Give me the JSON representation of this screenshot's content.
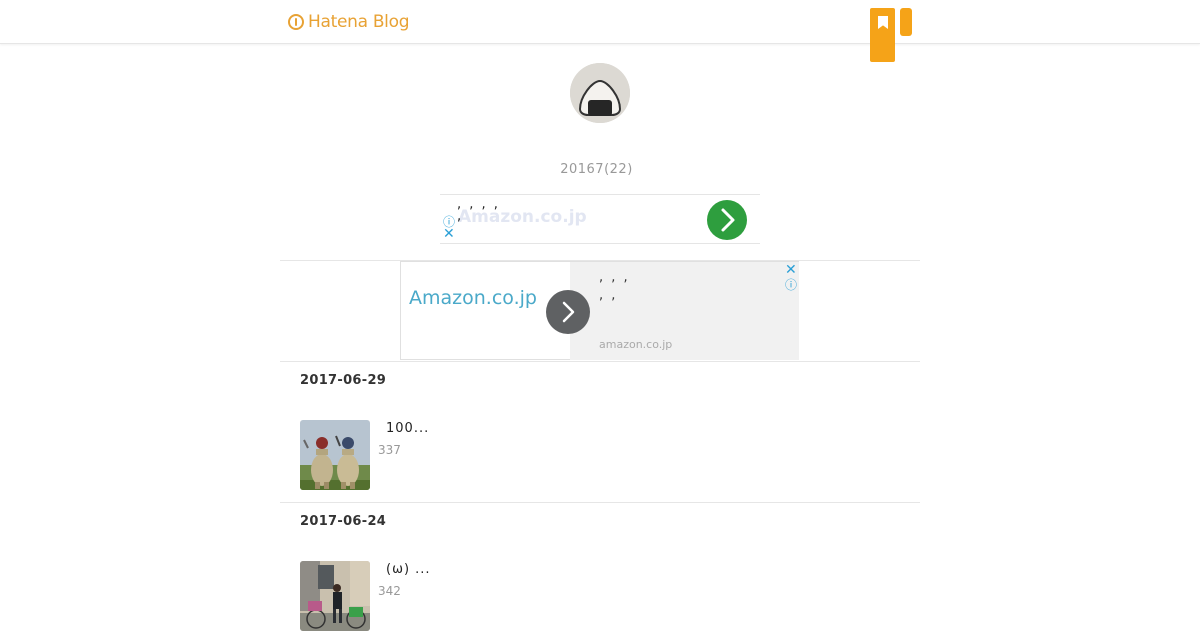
{
  "header": {
    "logo_text": "Hatena Blog",
    "brand_color": "#e8a234",
    "bookmark_button_icon": "bookmark-icon",
    "menu_button_icon": "menu-icon"
  },
  "archive": {
    "title": "20167(22)"
  },
  "ad_top": {
    "line1": ", , , ,",
    "line2": ",",
    "brand": "Amazon.co.jp",
    "go_icon": "chevron-right-icon",
    "info_icon": "info-icon",
    "close_icon": "close-icon"
  },
  "ad_main": {
    "brand": "Amazon.co.jp",
    "line1": ", , ,",
    "line2": ", ,",
    "domain": "amazon.co.jp",
    "go_icon": "chevron-right-icon",
    "info_icon": "info-icon",
    "close_icon": "close-icon"
  },
  "entries": [
    {
      "date": "2017-06-29",
      "title": "100...",
      "count": "337",
      "thumbnail": "statues-photo"
    },
    {
      "date": "2017-06-24",
      "title": "(ω) ...",
      "count": "342",
      "thumbnail": "person-bicycle-photo"
    }
  ]
}
